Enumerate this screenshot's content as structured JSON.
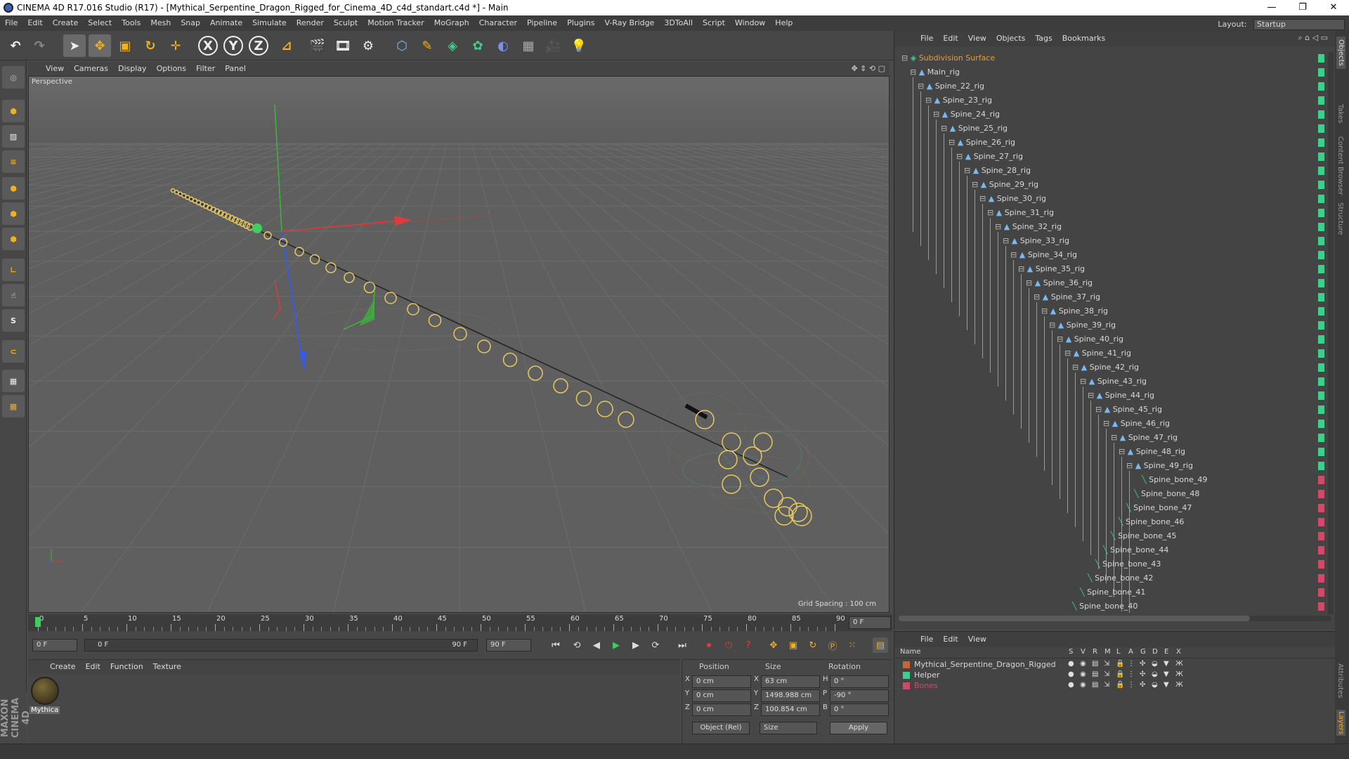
{
  "window": {
    "title": "CINEMA 4D R17.016 Studio (R17) - [Mythical_Serpentine_Dragon_Rigged_for_Cinema_4D_c4d_standart.c4d *] - Main",
    "min": "—",
    "max": "❐",
    "close": "✕"
  },
  "menubar": {
    "items": [
      "File",
      "Edit",
      "Create",
      "Select",
      "Tools",
      "Mesh",
      "Snap",
      "Animate",
      "Simulate",
      "Render",
      "Sculpt",
      "Motion Tracker",
      "MoGraph",
      "Character",
      "Pipeline",
      "Plugins",
      "V-Ray Bridge",
      "3DToAll",
      "Script",
      "Window",
      "Help"
    ],
    "layout_label": "Layout:",
    "layout_value": "Startup"
  },
  "viewport": {
    "menu": [
      "View",
      "Cameras",
      "Display",
      "Options",
      "Filter",
      "Panel"
    ],
    "label": "Perspective",
    "grid_spacing": "Grid Spacing : 100 cm"
  },
  "timeline": {
    "ticks": [
      "0",
      "5",
      "10",
      "15",
      "20",
      "25",
      "30",
      "35",
      "40",
      "45",
      "50",
      "55",
      "60",
      "65",
      "70",
      "75",
      "80",
      "85",
      "90"
    ],
    "current_frame": "0 F",
    "start": "0 F",
    "range_start": "0 F",
    "range_end": "90 F",
    "end": "90 F"
  },
  "material": {
    "menu": [
      "Create",
      "Edit",
      "Function",
      "Texture"
    ],
    "name": "Mythica"
  },
  "coords": {
    "headers": [
      "Position",
      "Size",
      "Rotation"
    ],
    "rows": [
      {
        "axis": "X",
        "pos": "0 cm",
        "size_axis": "X",
        "size": "63 cm",
        "rot_axis": "H",
        "rot": "0 °"
      },
      {
        "axis": "Y",
        "pos": "0 cm",
        "size_axis": "Y",
        "size": "1498.988 cm",
        "rot_axis": "P",
        "rot": "-90 °"
      },
      {
        "axis": "Z",
        "pos": "0 cm",
        "size_axis": "Z",
        "size": "100.854 cm",
        "rot_axis": "B",
        "rot": "0 °"
      }
    ],
    "mode": "Object (Rel)",
    "size_mode": "Size",
    "apply": "Apply"
  },
  "objects": {
    "menu": [
      "File",
      "Edit",
      "View",
      "Objects",
      "Tags",
      "Bookmarks"
    ],
    "root": "Subdivision Surface",
    "items": [
      "Main_rig",
      "Spine_22_rig",
      "Spine_23_rig",
      "Spine_24_rig",
      "Spine_25_rig",
      "Spine_26_rig",
      "Spine_27_rig",
      "Spine_28_rig",
      "Spine_29_rig",
      "Spine_30_rig",
      "Spine_31_rig",
      "Spine_32_rig",
      "Spine_33_rig",
      "Spine_34_rig",
      "Spine_35_rig",
      "Spine_36_rig",
      "Spine_37_rig",
      "Spine_38_rig",
      "Spine_39_rig",
      "Spine_40_rig",
      "Spine_41_rig",
      "Spine_42_rig",
      "Spine_43_rig",
      "Spine_44_rig",
      "Spine_45_rig",
      "Spine_46_rig",
      "Spine_47_rig",
      "Spine_48_rig",
      "Spine_49_rig"
    ],
    "bones": [
      "Spine_bone_49",
      "Spine_bone_48",
      "Spine_bone_47",
      "Spine_bone_46",
      "Spine_bone_45",
      "Spine_bone_44",
      "Spine_bone_43",
      "Spine_bone_42",
      "Spine_bone_41",
      "Spine_bone_40"
    ]
  },
  "layers": {
    "menu": [
      "File",
      "Edit",
      "View"
    ],
    "columns": [
      "Name",
      "S",
      "V",
      "R",
      "M",
      "L",
      "A",
      "G",
      "D",
      "E",
      "X"
    ],
    "rows": [
      {
        "name": "Mythical_Serpentine_Dragon_Rigged",
        "color": "#c8643c"
      },
      {
        "name": "Helper",
        "color": "#3ecf8a"
      },
      {
        "name": "Bones",
        "color": "#d04a6a"
      }
    ]
  },
  "side_tabs": [
    "Objects",
    "Takes",
    "Content Browser",
    "Structure",
    "Attributes",
    "Layers"
  ],
  "brand": "MAXON CINEMA 4D",
  "colors": {
    "accent_green": "#3ecf8a",
    "bone_red": "#d04a6a",
    "root_orange": "#e0a040"
  }
}
